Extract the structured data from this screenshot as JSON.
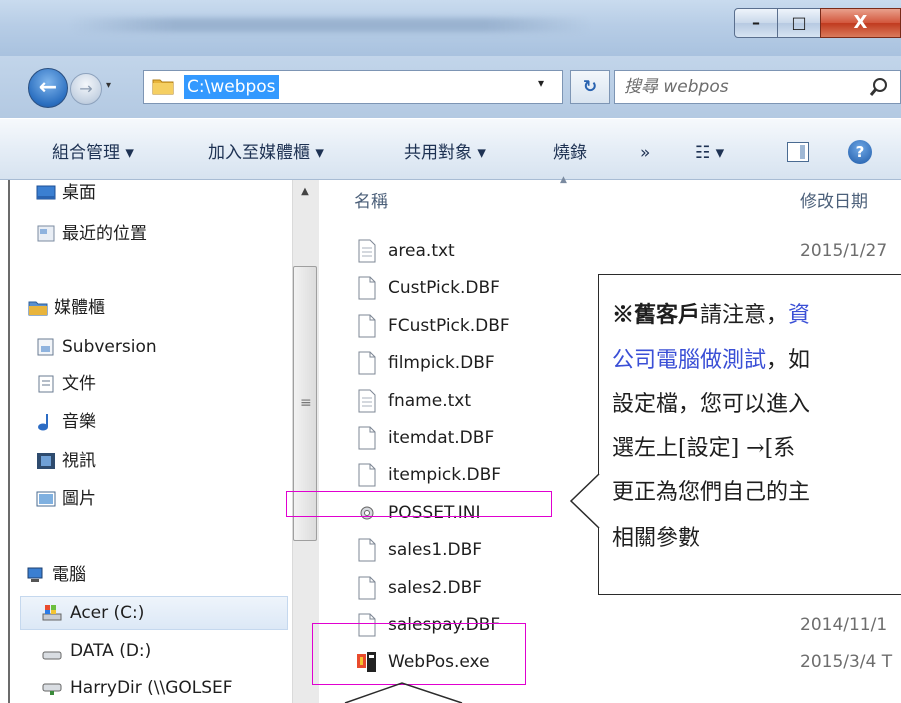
{
  "window": {
    "controls": {
      "minimize": "–",
      "maximize": "□",
      "close": "X"
    }
  },
  "nav": {
    "back_glyph": "←",
    "forward_glyph": "→",
    "history_glyph": "▾",
    "address": "C:\\webpos",
    "address_dropdown_glyph": "▾",
    "refresh_glyph": "↻",
    "search_placeholder": "搜尋 webpos"
  },
  "commands": [
    {
      "label": "組合管理 ▾"
    },
    {
      "label": "加入至媒體櫃 ▾"
    },
    {
      "label": "共用對象 ▾"
    },
    {
      "label": "燒錄"
    },
    {
      "label": "»"
    },
    {
      "label": "☷ ▾"
    }
  ],
  "help_glyph": "?",
  "sidebar": {
    "items": [
      {
        "label": "桌面",
        "icon": "desktop-icon"
      },
      {
        "label": "最近的位置",
        "icon": "recent-places-icon"
      },
      {
        "label": "媒體櫃",
        "icon": "libraries-icon"
      },
      {
        "label": "Subversion",
        "icon": "library-folder-icon"
      },
      {
        "label": "文件",
        "icon": "documents-icon"
      },
      {
        "label": "音樂",
        "icon": "music-icon"
      },
      {
        "label": "視訊",
        "icon": "video-icon"
      },
      {
        "label": "圖片",
        "icon": "pictures-icon"
      },
      {
        "label": "電腦",
        "icon": "computer-icon"
      },
      {
        "label": "Acer (C:)",
        "icon": "drive-c-icon"
      },
      {
        "label": "DATA (D:)",
        "icon": "drive-d-icon"
      },
      {
        "label": "HarryDir (\\\\GOLSEF",
        "icon": "network-drive-icon"
      }
    ],
    "scroll_grip": "≡",
    "scroll_up_glyph": "▲"
  },
  "file_list": {
    "columns": {
      "name": "名稱",
      "date": "修改日期"
    },
    "sort_glyph": "▲",
    "files": [
      {
        "name": "area.txt",
        "date": "2015/1/27",
        "icon": "text-file-icon"
      },
      {
        "name": "CustPick.DBF",
        "date": "",
        "icon": "file-icon"
      },
      {
        "name": "FCustPick.DBF",
        "date": "",
        "icon": "file-icon"
      },
      {
        "name": "filmpick.DBF",
        "date": "",
        "icon": "file-icon"
      },
      {
        "name": "fname.txt",
        "date": "",
        "icon": "text-file-icon"
      },
      {
        "name": "itemdat.DBF",
        "date": "",
        "icon": "file-icon"
      },
      {
        "name": "itempick.DBF",
        "date": "",
        "icon": "file-icon"
      },
      {
        "name": "POSSET.INI",
        "date": "",
        "icon": "settings-file-icon"
      },
      {
        "name": "sales1.DBF",
        "date": "",
        "icon": "file-icon"
      },
      {
        "name": "sales2.DBF",
        "date": "",
        "icon": "file-icon"
      },
      {
        "name": "salespay.DBF",
        "date": "2014/11/1",
        "icon": "file-icon"
      },
      {
        "name": "WebPos.exe",
        "date": "2015/3/4 T",
        "icon": "exe-icon"
      }
    ]
  },
  "annotation": {
    "lines": [
      {
        "parts": [
          {
            "text": "※",
            "style": "bold"
          },
          {
            "text": "舊客戶",
            "style": "bold"
          },
          {
            "text": "請注意，",
            "style": ""
          },
          {
            "text": "資",
            "style": "blue"
          }
        ]
      },
      {
        "parts": [
          {
            "text": "公司電腦做測試",
            "style": "blue"
          },
          {
            "text": "，如",
            "style": ""
          }
        ]
      },
      {
        "parts": [
          {
            "text": "設定檔，您可以進入",
            "style": ""
          }
        ]
      },
      {
        "parts": [
          {
            "text": "選左上[設定] →[系",
            "style": ""
          }
        ]
      },
      {
        "parts": [
          {
            "text": "更正為您們自己的主",
            "style": ""
          }
        ]
      },
      {
        "parts": [
          {
            "text": "相關參數",
            "style": ""
          }
        ]
      }
    ],
    "highlight_color": "#e000d0",
    "link_color": "#3a4fd6"
  }
}
